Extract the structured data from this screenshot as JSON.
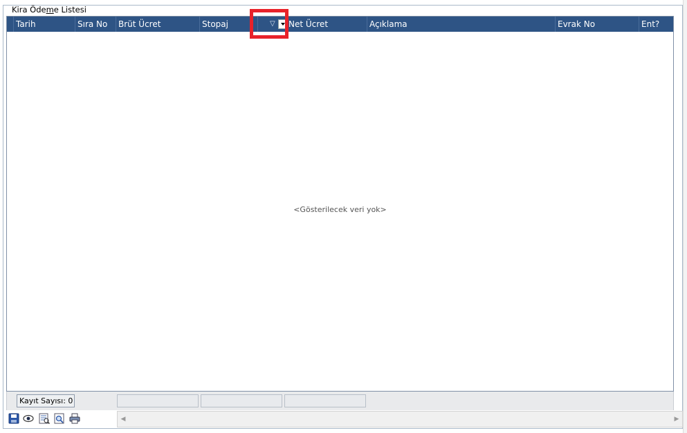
{
  "groupbox": {
    "title_pre": "Kira Öde",
    "title_underline": "m",
    "title_post": "e Listesi"
  },
  "grid": {
    "columns": [
      {
        "label": "Tarih"
      },
      {
        "label": "Sıra No"
      },
      {
        "label": "Brüt Ücret"
      },
      {
        "label": "Stopaj"
      },
      {
        "label": "Net Ücret"
      },
      {
        "label": "Açıklama"
      },
      {
        "label": "Evrak No"
      },
      {
        "label": "Ent?"
      }
    ],
    "filter_symbol": "▽",
    "empty_message": "<Gösterilecek veri yok>"
  },
  "footer": {
    "record_count": "Kayıt Sayısı: 0"
  },
  "toolbar": {
    "icons": [
      "save-icon",
      "view-icon",
      "report-icon",
      "preview-icon",
      "print-icon"
    ]
  },
  "scrollbar": {
    "left_arrow": "◀",
    "right_arrow": "▶"
  },
  "colors": {
    "header_bg": "#2e5485",
    "highlight": "#e8222a"
  }
}
